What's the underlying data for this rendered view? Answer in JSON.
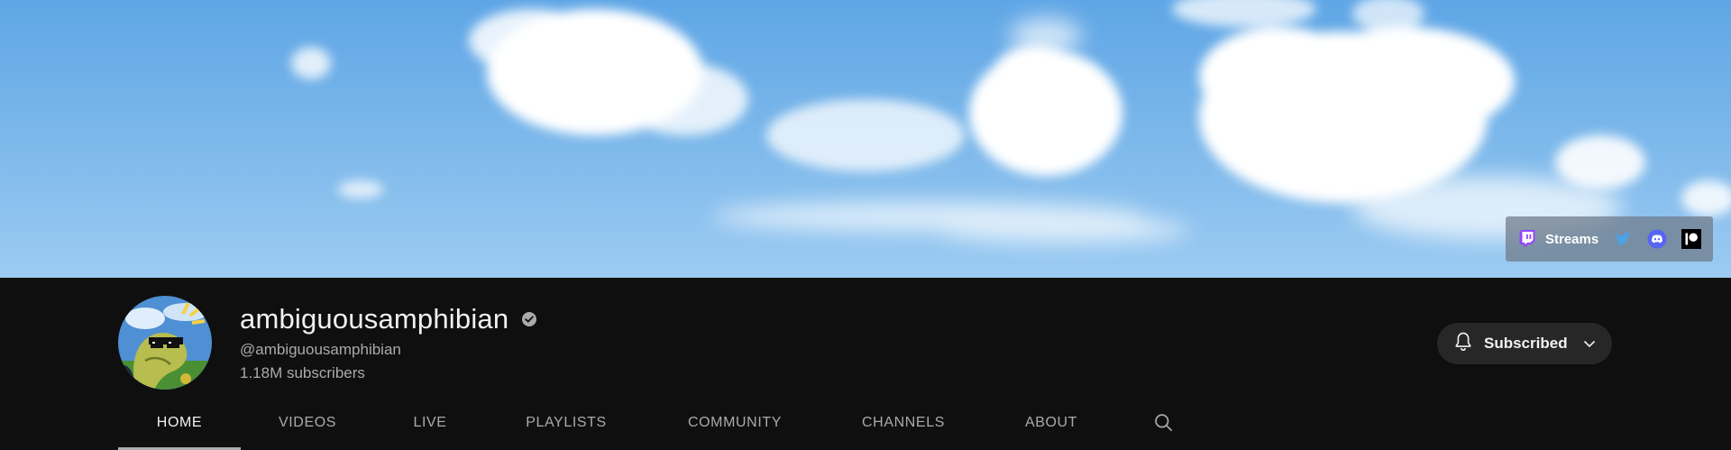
{
  "banner": {
    "links": {
      "main_label": "Streams",
      "icons": [
        "twitch-icon",
        "twitter-icon",
        "discord-icon",
        "patreon-icon"
      ]
    },
    "colors": {
      "sky": "#79b6ea",
      "twitch": "#9146ff",
      "discord": "#5865f2"
    }
  },
  "channel": {
    "name": "ambiguousamphibian",
    "handle": "@ambiguousamphibian",
    "subscribers": "1.18M subscribers",
    "verified_icon": "verified-check-icon"
  },
  "subscribe": {
    "label": "Subscribed",
    "icons": [
      "bell-icon",
      "chevron-down-icon"
    ],
    "bg": "#272727"
  },
  "tabs": [
    {
      "label": "HOME",
      "active": true
    },
    {
      "label": "VIDEOS"
    },
    {
      "label": "LIVE"
    },
    {
      "label": "PLAYLISTS"
    },
    {
      "label": "COMMUNITY"
    },
    {
      "label": "CHANNELS"
    },
    {
      "label": "ABOUT"
    }
  ],
  "search_icon": "search-icon"
}
